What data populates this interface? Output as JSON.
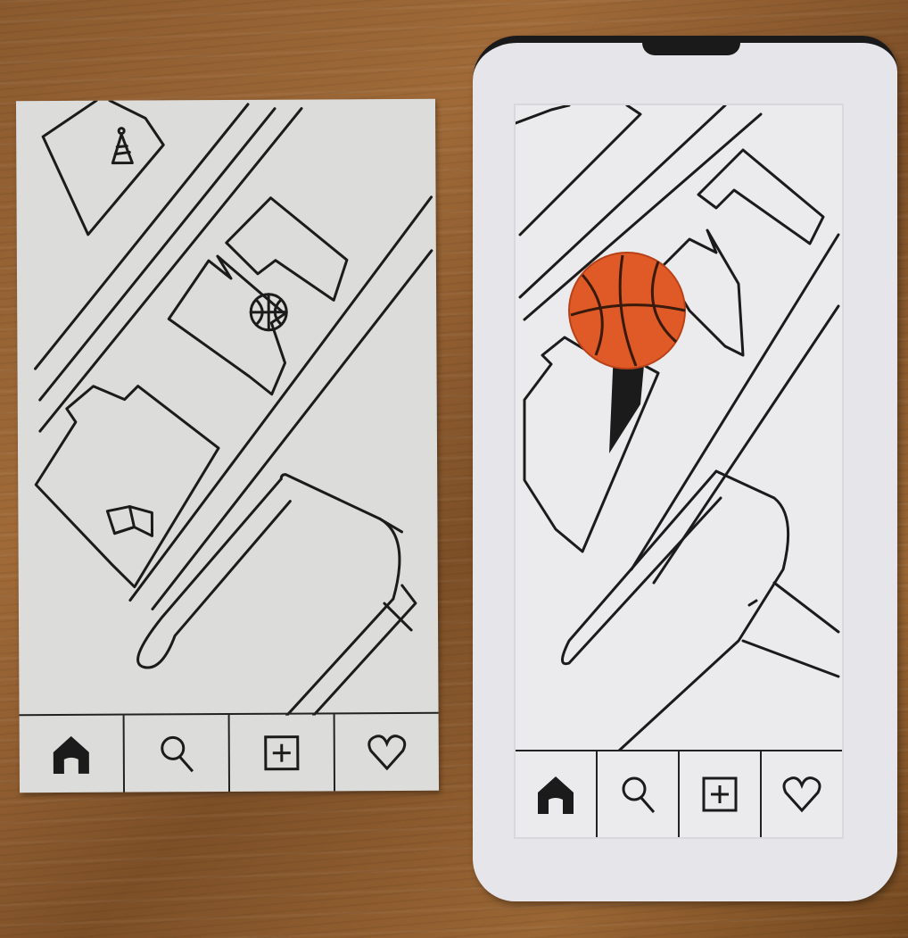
{
  "sketches": [
    {
      "id": "paper-sketch",
      "view": "map-overview",
      "markers": [
        {
          "icon": "party-hat-icon"
        },
        {
          "icon": "basketball-icon"
        },
        {
          "icon": "book-icon"
        }
      ],
      "tabs": [
        {
          "icon": "home-icon",
          "active": true
        },
        {
          "icon": "search-icon",
          "active": false
        },
        {
          "icon": "add-icon",
          "active": false
        },
        {
          "icon": "heart-icon",
          "active": false
        }
      ]
    },
    {
      "id": "phone-prototype",
      "view": "map-with-selected-pin",
      "markers": [
        {
          "icon": "basketball-pin-icon",
          "color": "#e05a28"
        }
      ],
      "tabs": [
        {
          "icon": "home-icon",
          "active": true
        },
        {
          "icon": "search-icon",
          "active": false
        },
        {
          "icon": "add-icon",
          "active": false
        },
        {
          "icon": "heart-icon",
          "active": false
        }
      ]
    }
  ],
  "colors": {
    "ink": "#1b1b1b",
    "paper": "#dcdcda",
    "pin": "#e05a28",
    "table": "#8a5a2e"
  }
}
